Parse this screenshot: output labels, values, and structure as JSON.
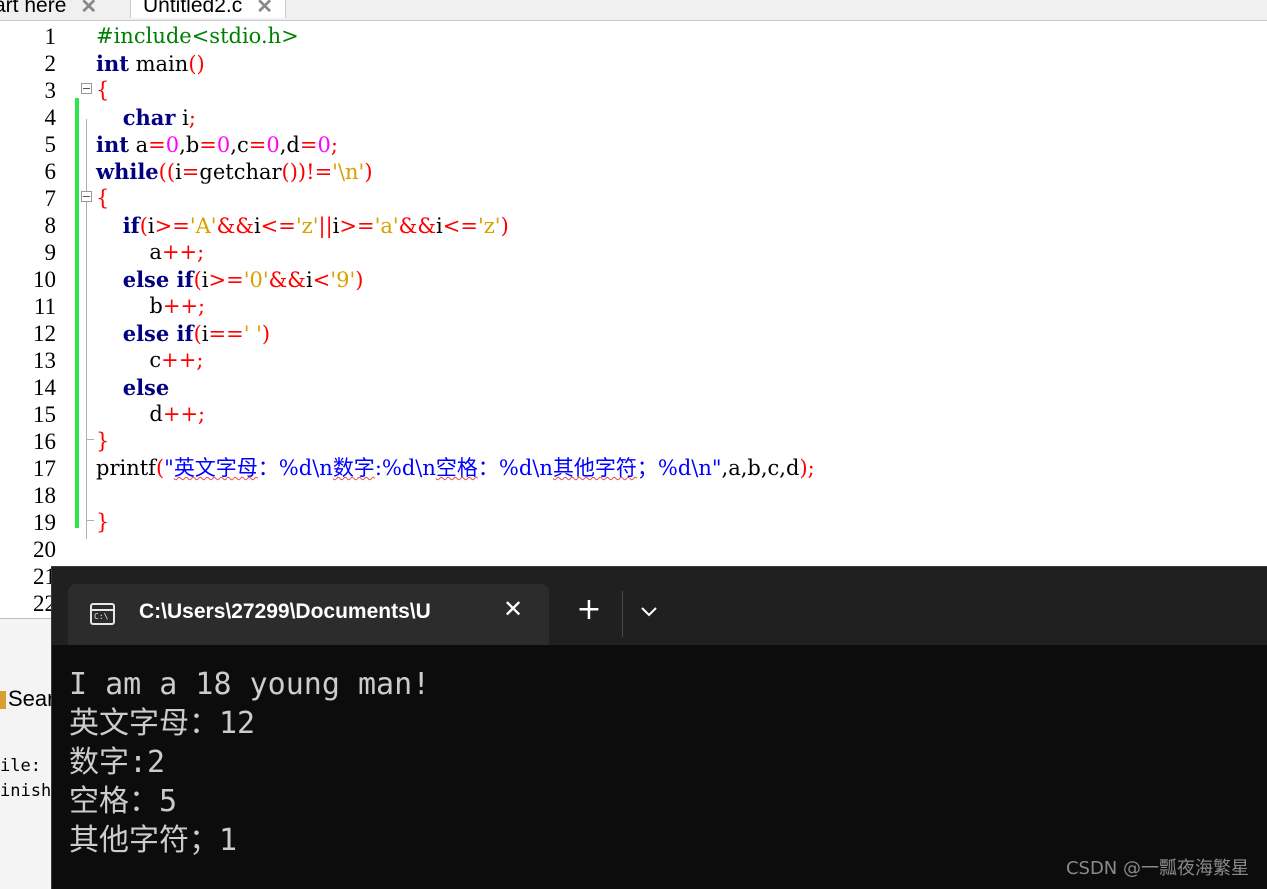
{
  "ide": {
    "tabs": [
      {
        "label": "art here",
        "close": "✕"
      },
      {
        "label": "Untitled2.c",
        "close": "✕"
      }
    ],
    "line_numbers": [
      "1",
      "2",
      "3",
      "4",
      "5",
      "6",
      "7",
      "8",
      "9",
      "10",
      "11",
      "12",
      "13",
      "14",
      "15",
      "16",
      "17",
      "18",
      "19",
      "20",
      "21",
      "22"
    ],
    "code": {
      "l1": "#include<stdio.h>",
      "l2_kw": "int",
      "l2_rest": " main",
      "l2_paren": "()",
      "l3": "{",
      "l4_kw": "char",
      "l4_id": " i",
      "l4_semi": ";",
      "l5_kw": "int",
      "l5_a": " a",
      "l5_b": "b",
      "l5_c": "c",
      "l5_d": "d",
      "zero": "0",
      "l6_kw": "while",
      "l6_id": "i",
      "l6_fn": "getchar",
      "l6_ch": "'\\n'",
      "l7": "{",
      "l8_kw": "if",
      "ch_A": "'A'",
      "ch_z": "'z'",
      "ch_a": "'a'",
      "a_inc": "a",
      "else_if": "else if",
      "ch_0": "'0'",
      "ch_9": "'9'",
      "b_inc": "b",
      "ch_sp": "' '",
      "c_inc": "c",
      "else": "else",
      "d_inc": "d",
      "l16": "}",
      "l17_fn": "printf",
      "l17_s1": "\"",
      "l17_z1": "英文字母",
      "l17_s2": "：%d\\n",
      "l17_z2": "数字",
      "l17_s3": ":%d\\n",
      "l17_z3": "空格",
      "l17_s4": "：%d\\n",
      "l17_z4": "其他字符",
      "l17_s5": "；%d\\n\"",
      "l17_args": "a,b,c,d",
      "l19": "}"
    },
    "lower": {
      "search_tab": "Sear",
      "log_1": "ile:",
      "log_2": "inish"
    }
  },
  "terminal": {
    "tab_title": "C:\\Users\\27299\\Documents\\U",
    "tab_icon_text": "C:\\",
    "close_glyph": "✕",
    "new_tab_glyph": "+",
    "output": [
      "I am a 18 young man!",
      "英文字母：12",
      "数字:2",
      "空格：5",
      "其他字符；1"
    ]
  },
  "watermark": "CSDN @一瓢夜海繁星",
  "colors": {
    "keyword": "#000080",
    "preprocessor": "#008000",
    "operator": "#ff0000",
    "number": "#ff00ff",
    "char_literal": "#d9a000",
    "format_string": "#0000ff",
    "change_bar": "#2ee64a",
    "terminal_bg": "#0c0c0c",
    "terminal_text": "#cccccc"
  }
}
